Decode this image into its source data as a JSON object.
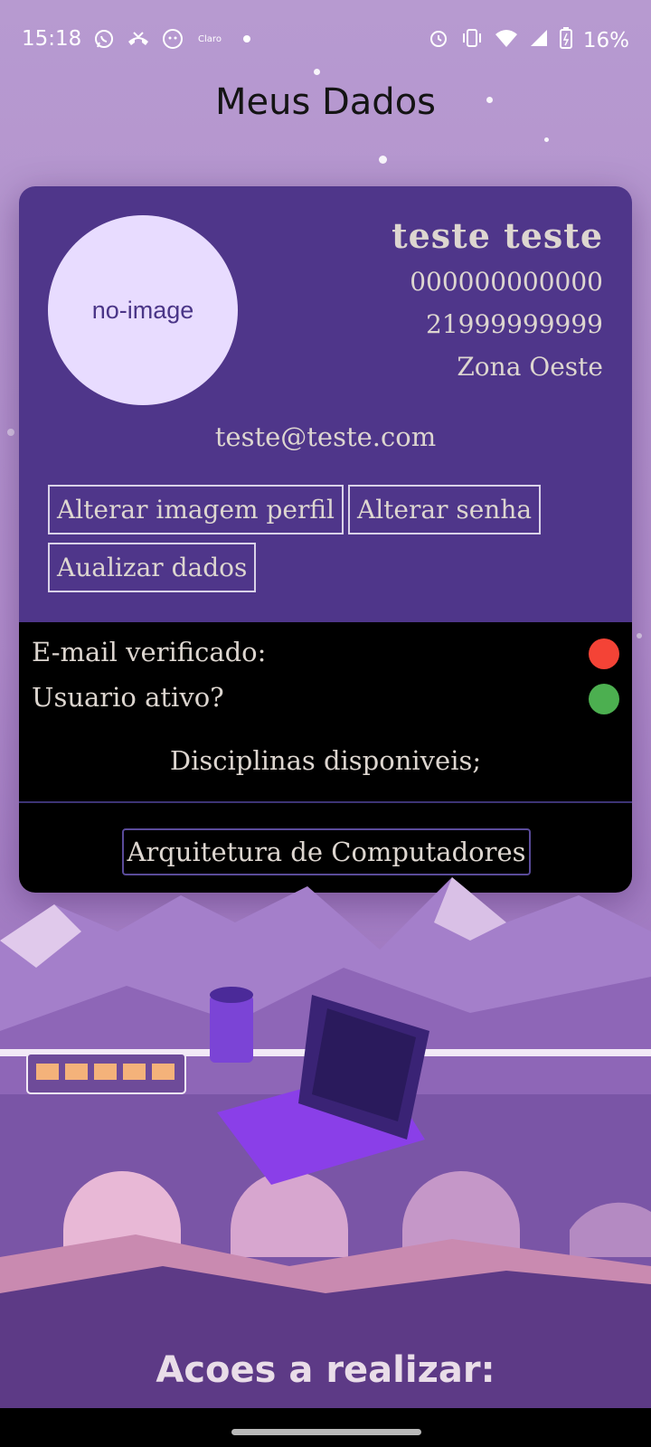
{
  "status_bar": {
    "time": "15:18",
    "left_icons": [
      "whatsapp-icon",
      "missed-call-icon",
      "cat-app-icon",
      "claro-icon",
      "dot-icon"
    ],
    "claro_label": "Claro",
    "battery": "16%"
  },
  "header": {
    "title": "Meus Dados"
  },
  "profile": {
    "avatar_text": "no-image",
    "name": "teste  teste",
    "id_number": "000000000000",
    "phone": "21999999999",
    "region": "Zona Oeste",
    "email": "teste@teste.com"
  },
  "actions": {
    "change_image": "Alterar imagem perfil",
    "change_password": "Alterar senha",
    "update_data": "Aualizar dados"
  },
  "verification": {
    "email_label": "E-mail verificado:",
    "email_status_color": "#f44336",
    "active_label": "Usuario ativo?",
    "active_status_color": "#4caf50"
  },
  "disciplines": {
    "title": "Disciplinas disponiveis;",
    "items": [
      "Arquitetura de Computadores"
    ]
  },
  "footer": {
    "title": "Acoes a realizar:"
  },
  "colors": {
    "card_top": "#4f368a",
    "card_bottom": "#000000",
    "avatar_bg": "#e8dcff"
  }
}
